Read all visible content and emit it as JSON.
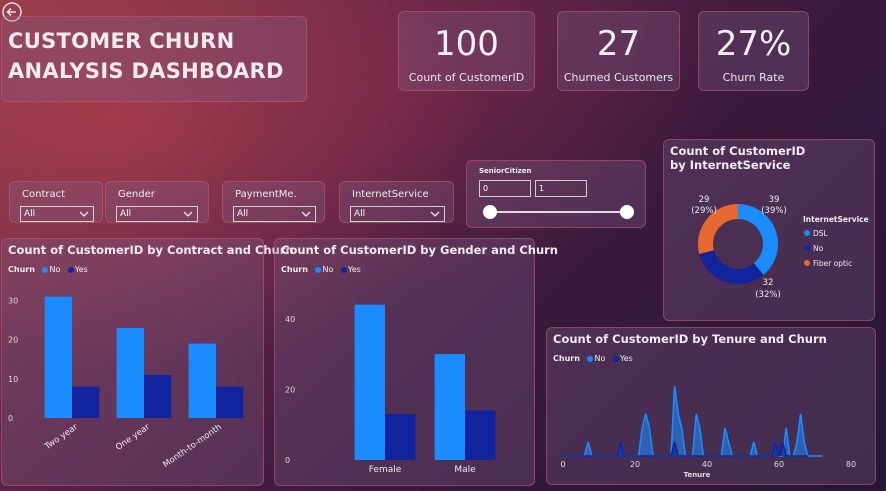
{
  "header": {
    "title_line1": "CUSTOMER CHURN",
    "title_line2": "ANALYSIS DASHBOARD"
  },
  "kpis": [
    {
      "value": "100",
      "label": "Count of CustomerID"
    },
    {
      "value": "27",
      "label": "Churned Customers"
    },
    {
      "value": "27%",
      "label": "Churn Rate"
    }
  ],
  "slicers": [
    {
      "label": "Contract",
      "value": "All"
    },
    {
      "label": "Gender",
      "value": "All"
    },
    {
      "label": "PaymentMe...",
      "value": "All"
    },
    {
      "label": "InternetService",
      "value": "All"
    }
  ],
  "senior_slider": {
    "label": "SeniorCitizen",
    "min_value": "0",
    "max_value": "1"
  },
  "legend": {
    "title": "Churn",
    "no": "No",
    "yes": "Yes"
  },
  "colors": {
    "no": "#1a8cff",
    "yes": "#12239e",
    "fiber": "#e8692f",
    "panel_border": "#c85a6e"
  },
  "icons": {
    "back": "back-arrow-icon",
    "chevron": "chevron-down-icon"
  },
  "chart_data": [
    {
      "id": "contract",
      "type": "bar",
      "title": "Count of CustomerID by Contract and Churn",
      "categories": [
        "Two year",
        "One year",
        "Month-to-month"
      ],
      "series": [
        {
          "name": "No",
          "values": [
            31,
            23,
            19
          ]
        },
        {
          "name": "Yes",
          "values": [
            8,
            11,
            8
          ]
        }
      ],
      "yticks": [
        "30",
        "20",
        "10",
        "0"
      ],
      "ylim": [
        0,
        35
      ]
    },
    {
      "id": "gender",
      "type": "bar",
      "title": "Count of CustomerID by Gender and Churn",
      "categories": [
        "Female",
        "Male"
      ],
      "series": [
        {
          "name": "No",
          "values": [
            44,
            30
          ]
        },
        {
          "name": "Yes",
          "values": [
            13,
            14
          ]
        }
      ],
      "yticks": [
        "40",
        "20",
        "0"
      ],
      "ylim": [
        0,
        49
      ]
    },
    {
      "id": "internet",
      "type": "pie",
      "title": "Count of CustomerID by InternetService",
      "legend_title": "InternetService",
      "slices": [
        {
          "name": "DSL",
          "value": 39,
          "label_value": "39",
          "label_pct": "(39%)"
        },
        {
          "name": "No",
          "value": 32,
          "label_value": "32",
          "label_pct": "(32%)"
        },
        {
          "name": "Fiber optic",
          "value": 29,
          "label_value": "29",
          "label_pct": "(29%)"
        }
      ]
    },
    {
      "id": "tenure",
      "type": "area",
      "title": "Count of CustomerID by Tenure and Churn",
      "xlabel": "Tenure",
      "xticks": [
        "0",
        "20",
        "40",
        "60",
        "80"
      ],
      "xlim": [
        0,
        80
      ],
      "ylim": [
        0,
        6
      ],
      "series": [
        {
          "name": "No",
          "points": [
            [
              0,
              0
            ],
            [
              6,
              0
            ],
            [
              7,
              1
            ],
            [
              8,
              0
            ],
            [
              15,
              0
            ],
            [
              16,
              1
            ],
            [
              17,
              0
            ],
            [
              21,
              0
            ],
            [
              22,
              2
            ],
            [
              23,
              3
            ],
            [
              24,
              2
            ],
            [
              25,
              0
            ],
            [
              30,
              0
            ],
            [
              31,
              5
            ],
            [
              32,
              3
            ],
            [
              33,
              2
            ],
            [
              34,
              0
            ],
            [
              36,
              0
            ],
            [
              37,
              3
            ],
            [
              38,
              2
            ],
            [
              39,
              0
            ],
            [
              44,
              0
            ],
            [
              45,
              2
            ],
            [
              46,
              1
            ],
            [
              47,
              0
            ],
            [
              52,
              0
            ],
            [
              53,
              1
            ],
            [
              54,
              0
            ],
            [
              58,
              0
            ],
            [
              59,
              1
            ],
            [
              60,
              0
            ],
            [
              61,
              0
            ],
            [
              62,
              2
            ],
            [
              63,
              0
            ],
            [
              64,
              0
            ],
            [
              65,
              1
            ],
            [
              66,
              3
            ],
            [
              67,
              1
            ],
            [
              68,
              0
            ],
            [
              70,
              0
            ],
            [
              72,
              0
            ]
          ]
        },
        {
          "name": "Yes",
          "points": [
            [
              0,
              0
            ],
            [
              15,
              0
            ],
            [
              16,
              1
            ],
            [
              17,
              0
            ],
            [
              30,
              0
            ],
            [
              31,
              1
            ],
            [
              32,
              0
            ],
            [
              58,
              0
            ],
            [
              59,
              1
            ],
            [
              60,
              0
            ],
            [
              61,
              1
            ],
            [
              62,
              0
            ],
            [
              68,
              0
            ]
          ]
        }
      ]
    }
  ]
}
